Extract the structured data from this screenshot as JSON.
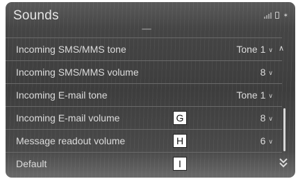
{
  "header": {
    "title": "Sounds",
    "status_icons": [
      "signal-icon",
      "phone-icon",
      "bluetooth-icon"
    ]
  },
  "settings": [
    {
      "label": "Incoming SMS/MMS tone",
      "value": "Tone 1",
      "callout": ""
    },
    {
      "label": "Incoming SMS/MMS volume",
      "value": "8",
      "callout": ""
    },
    {
      "label": "Incoming E-mail tone",
      "value": "Tone 1",
      "callout": ""
    },
    {
      "label": "Incoming E-mail volume",
      "value": "8",
      "callout": "G"
    },
    {
      "label": "Message readout volume",
      "value": "6",
      "callout": "H"
    },
    {
      "label": "Default",
      "value": "",
      "callout": "I"
    }
  ],
  "scrollbar": {
    "up_icon": "chevron-up-icon",
    "down_icon": "double-chevron-down-icon"
  }
}
